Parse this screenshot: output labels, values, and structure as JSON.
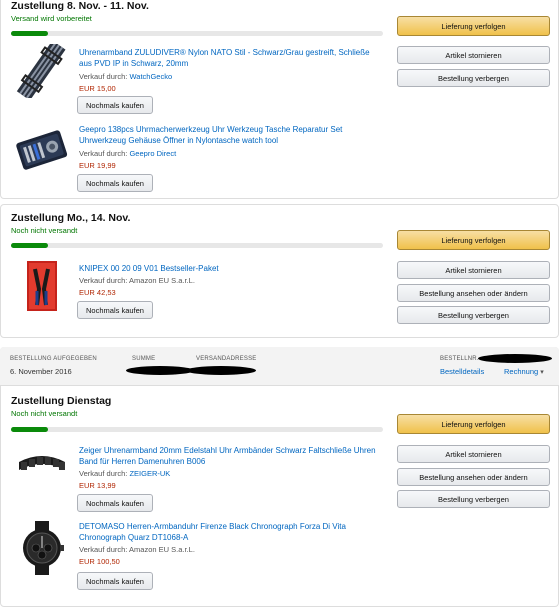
{
  "orders": [
    {
      "shipment_title": "Zustellung 8. Nov. - 11. Nov.",
      "status": "Versand wird vorbereitet",
      "progress": 0.1,
      "actions": [
        "Lieferung verfolgen",
        "Artikel stornieren",
        "Bestellung verbergen"
      ],
      "items": [
        {
          "title": "Uhrenarmband ZULUDIVER® Nylon NATO Stil - Schwarz/Grau gestreift, Schließe aus PVD IP in Schwarz, 20mm",
          "seller_prefix": "Verkauf durch:",
          "seller": "WatchGecko",
          "price": "EUR 15,00",
          "rebuy": "Nochmals kaufen"
        },
        {
          "title": "Geepro 138pcs Uhrmacherwerkzeug Uhr Werkzeug Tasche Reparatur Set Uhrwerkzeug Gehäuse Öffner in Nylontasche watch tool",
          "seller_prefix": "Verkauf durch:",
          "seller": "Geepro Direct",
          "price": "EUR 19,99",
          "rebuy": "Nochmals kaufen"
        }
      ]
    },
    {
      "shipment_title": "Zustellung Mo., 14. Nov.",
      "status": "Noch nicht versandt",
      "progress": 0.1,
      "actions": [
        "Lieferung verfolgen",
        "Artikel stornieren",
        "Bestellung ansehen oder ändern",
        "Bestellung verbergen"
      ],
      "items": [
        {
          "title": "KNIPEX 00 20 09 V01 Bestseller-Paket",
          "seller_prefix": "Verkauf durch:",
          "seller": "Amazon EU S.a.r.L.",
          "price": "EUR 42,53",
          "rebuy": "Nochmals kaufen"
        }
      ]
    },
    {
      "header": {
        "placed_label": "BESTELLUNG AUFGEGEBEN",
        "placed_date": "6. November 2016",
        "total_label": "SUMME",
        "address_label": "VERSANDADRESSE",
        "order_no_label": "BESTELLNR.",
        "details_link": "Bestelldetails",
        "invoice_link": "Rechnung",
        "invoice_caret": "▾"
      },
      "shipment_title": "Zustellung Dienstag",
      "status": "Noch nicht versandt",
      "progress": 0.1,
      "actions": [
        "Lieferung verfolgen",
        "Artikel stornieren",
        "Bestellung ansehen oder ändern",
        "Bestellung verbergen"
      ],
      "items": [
        {
          "title": "Zeiger Uhrenarmband 20mm Edelstahl Uhr Armbänder Schwarz Faltschließe Uhren Band für Herren Damenuhren B006",
          "seller_prefix": "Verkauf durch:",
          "seller": "ZEIGER-UK",
          "price": "EUR 13,99",
          "rebuy": "Nochmals kaufen"
        },
        {
          "title": "DETOMASO Herren-Armbanduhr Firenze Black Chronograph Forza Di Vita Chronograph Quarz DT1068-A",
          "seller_prefix": "Verkauf durch:",
          "seller": "Amazon EU S.a.r.L.",
          "price": "EUR 100,50",
          "rebuy": "Nochmals kaufen"
        }
      ]
    }
  ]
}
